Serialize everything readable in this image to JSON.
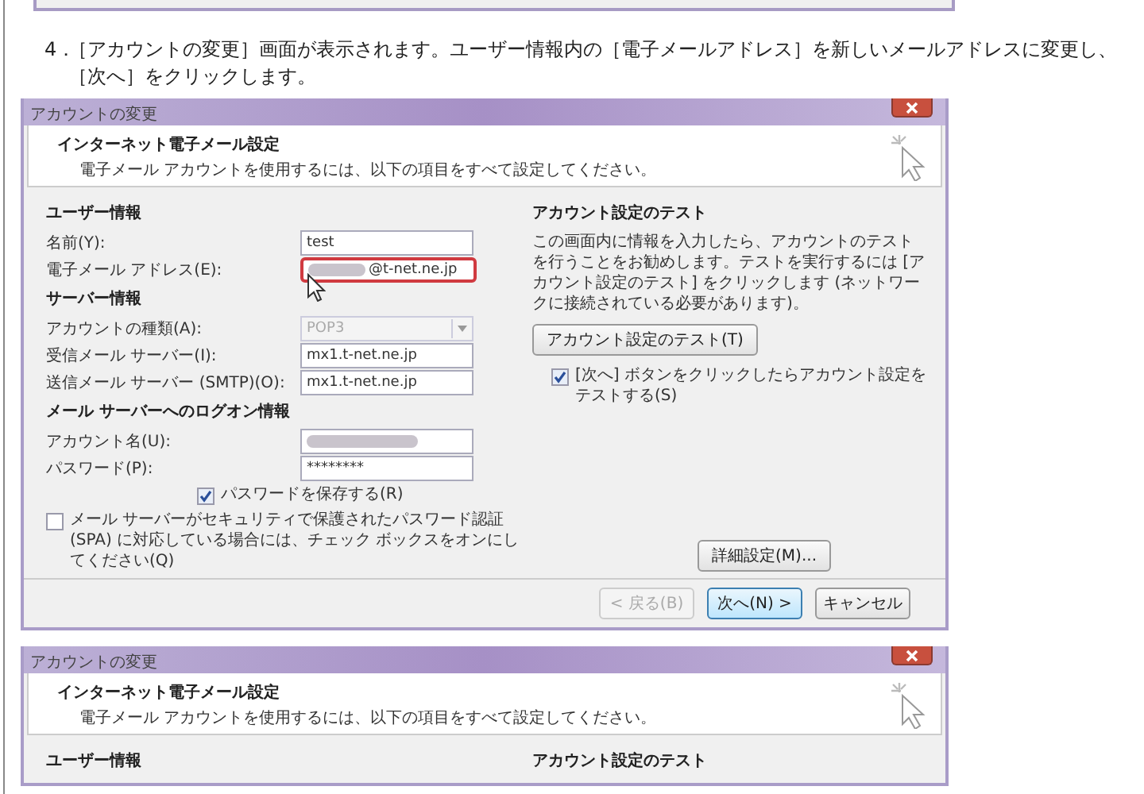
{
  "instruction": {
    "number": "4．",
    "text": "［アカウントの変更］画面が表示されます。ユーザー情報内の［電子メールアドレス］を新しいメールアドレスに変更し、［次へ］をクリックします。"
  },
  "dialogs": [
    {
      "title": "アカウントの変更",
      "header": {
        "title": "インターネット電子メール設定",
        "subtitle": "電子メール アカウントを使用するには、以下の項目をすべて設定してください。"
      },
      "sections": [
        {
          "heading": "ユーザー情報",
          "fields": [
            {
              "label": "名前(Y):",
              "kind": "text",
              "value": "test",
              "redacted": false,
              "highlighted": false,
              "disabled": false
            },
            {
              "label": "電子メール アドレス(E):",
              "kind": "text",
              "value": "@t-net.ne.jp",
              "redacted": true,
              "highlighted": true,
              "disabled": false
            }
          ]
        },
        {
          "heading": "サーバー情報",
          "fields": [
            {
              "label": "アカウントの種類(A):",
              "kind": "dropdown",
              "value": "POP3",
              "highlighted": false,
              "disabled": true
            },
            {
              "label": "受信メール サーバー(I):",
              "kind": "text",
              "value": "mx1.t-net.ne.jp",
              "redacted": false,
              "highlighted": false,
              "disabled": false
            },
            {
              "label": "送信メール サーバー (SMTP)(O):",
              "kind": "text",
              "value": "mx1.t-net.ne.jp",
              "redacted": false,
              "highlighted": false,
              "disabled": false
            }
          ]
        },
        {
          "heading": "メール サーバーへのログオン情報",
          "fields": [
            {
              "label": "アカウント名(U):",
              "kind": "text",
              "redacted": true,
              "highlighted": false,
              "disabled": false
            },
            {
              "label": "パスワード(P):",
              "kind": "text",
              "value": "********",
              "redacted": false,
              "highlighted": false,
              "disabled": false
            }
          ]
        }
      ],
      "save_password": {
        "label": "パスワードを保存する(R)",
        "checked": true
      },
      "spa": {
        "label": "メール サーバーがセキュリティで保護されたパスワード認証 (SPA) に対応している場合には、チェック ボックスをオンにしてください(Q)",
        "checked": false
      },
      "test": {
        "heading": "アカウント設定のテスト",
        "description": "この画面内に情報を入力したら、アカウントのテストを行うことをお勧めします。テストを実行するには [アカウント設定のテスト] をクリックします (ネットワークに接続されている必要があります)。",
        "button": "アカウント設定のテスト(T)",
        "checkbox": {
          "label": "[次へ] ボタンをクリックしたらアカウント設定をテストする(S)",
          "checked": true
        }
      },
      "advanced_button": "詳細設定(M)...",
      "buttons": [
        {
          "label": "< 戻る(B)",
          "disabled": true,
          "default": false
        },
        {
          "label": "次へ(N) >",
          "disabled": false,
          "default": true
        },
        {
          "label": "キャンセル",
          "disabled": false,
          "default": false
        }
      ]
    },
    {
      "title": "アカウントの変更",
      "header": {
        "title": "インターネット電子メール設定",
        "subtitle": "電子メール アカウントを使用するには、以下の項目をすべて設定してください。"
      },
      "sections": [
        {
          "heading": "ユーザー情報"
        }
      ],
      "test": {
        "heading": "アカウント設定のテスト"
      }
    }
  ]
}
